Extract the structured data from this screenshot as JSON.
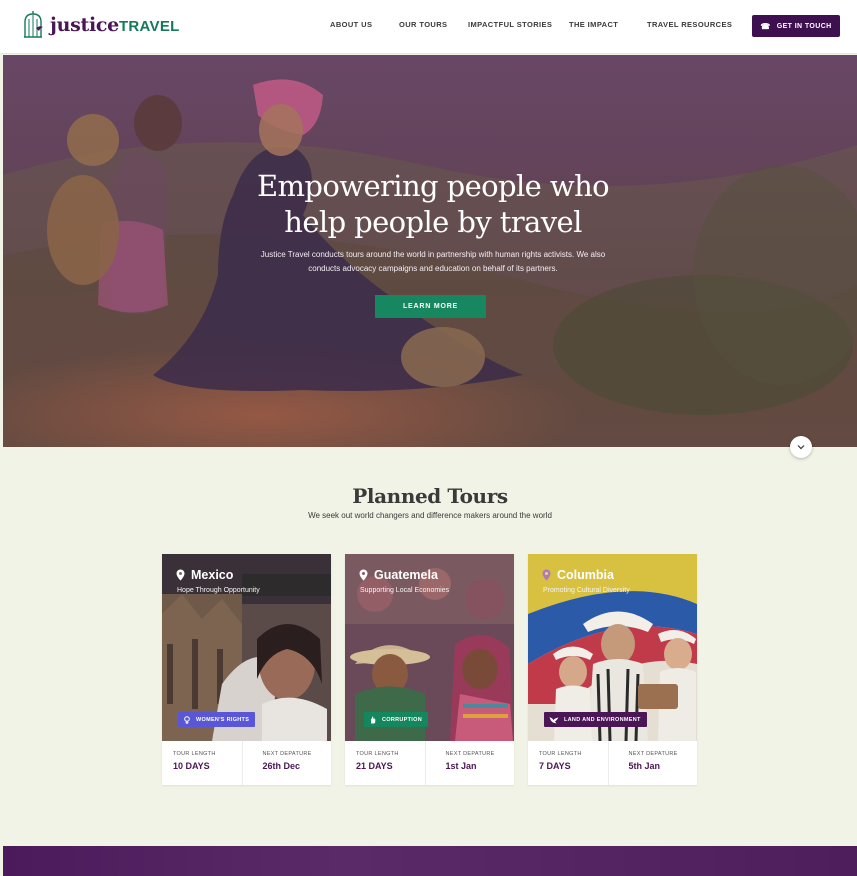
{
  "header": {
    "logo_main": "justice",
    "logo_secondary": "TRAVEL",
    "nav": [
      "ABOUT US",
      "OUR TOURS",
      "IMPACTFUL STORIES",
      "THE IMPACT",
      "TRAVEL RESOURCES"
    ],
    "cta_label": "GET IN TOUCH"
  },
  "hero": {
    "title_line1": "Empowering people who",
    "title_line2": "help people by travel",
    "subtitle_line1": "Justice Travel conducts tours around the world in partnership with human rights activists. We also",
    "subtitle_line2": "conducts advocacy campaigns and education on behalf of its partners.",
    "button_label": "LEARN MORE"
  },
  "tours_section": {
    "title": "Planned Tours",
    "subtitle": "We seek out world changers and difference makers around the world"
  },
  "tours": [
    {
      "country": "Mexico",
      "tagline": "Hope Through Opportunity",
      "badge": "WOMEN'S RIGHTS",
      "badge_color": "#5a57d6",
      "length_label": "TOUR LENGTH",
      "length": "10 DAYS",
      "departure_label": "NEXT DEPATURE",
      "departure": "26th Dec"
    },
    {
      "country": "Guatemela",
      "tagline": "Supporting Local Economies",
      "badge": "CORRUPTION",
      "badge_color": "#15875f",
      "length_label": "TOUR LENGTH",
      "length": "21 DAYS",
      "departure_label": "NEXT DEPATURE",
      "departure": "1st Jan"
    },
    {
      "country": "Columbia",
      "tagline": "Promoting Cultural Diversity",
      "badge": "LAND AND ENVIRONMENT",
      "badge_color": "#4a1656",
      "length_label": "TOUR LENGTH",
      "length": "7 DAYS",
      "departure_label": "NEXT DEPATURE",
      "departure": "5th Jan"
    }
  ],
  "colors": {
    "brand_purple": "#4a1656",
    "brand_green": "#157a5c",
    "cta_bg": "#3e1050",
    "page_bg": "#f0f3e6"
  }
}
